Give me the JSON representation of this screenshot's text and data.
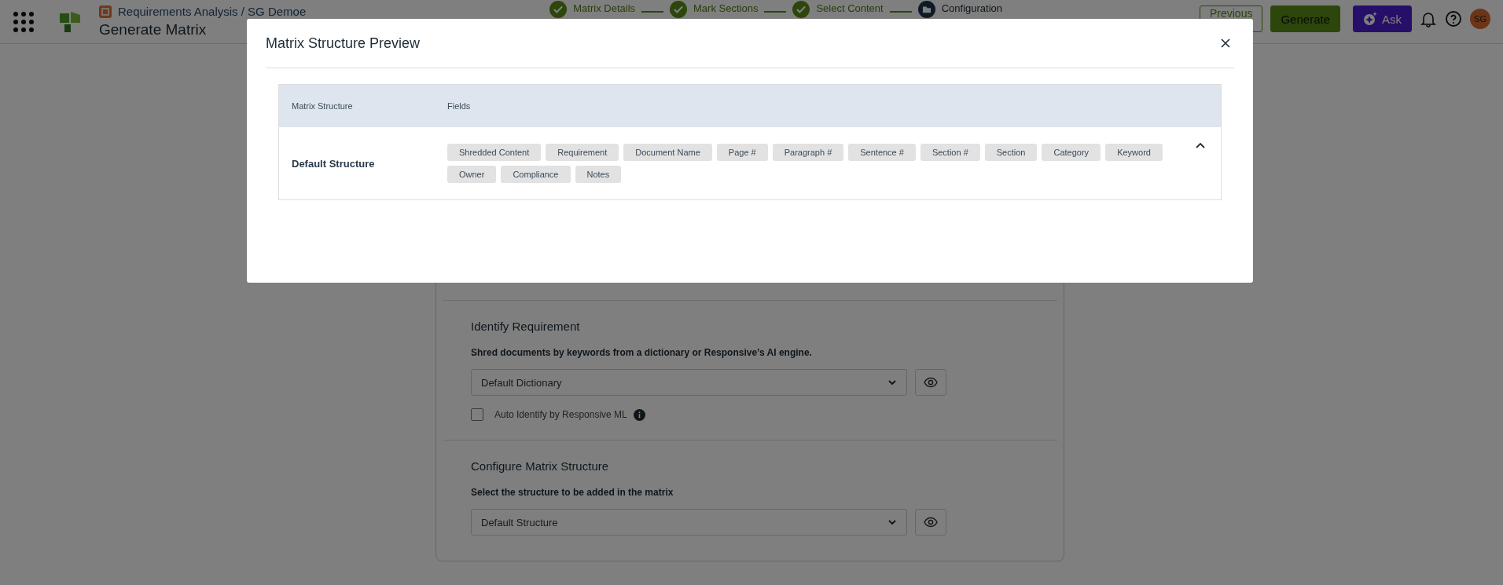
{
  "header": {
    "breadcrumb": "Requirements Analysis / SG Demoe",
    "title": "Generate Matrix",
    "steps": [
      {
        "label": "Matrix Details",
        "done": true
      },
      {
        "label": "Mark Sections",
        "done": true
      },
      {
        "label": "Select Content",
        "done": true
      },
      {
        "label": "Configuration",
        "done": false
      }
    ],
    "buttons": [
      {
        "label": "Previous",
        "kind": "outline"
      },
      {
        "label": "Generate",
        "kind": "primary"
      },
      {
        "label": "Ask",
        "kind": "ai"
      }
    ],
    "avatar": "SG"
  },
  "form": {
    "sections": [
      {
        "title": "Identify Requirement",
        "description": "Shred documents by keywords from a dictionary or Responsive’s AI engine.",
        "select": "Default Dictionary",
        "checkbox": {
          "label": "Auto Identify by Responsive ML",
          "checked": false
        }
      },
      {
        "title": "Configure Matrix Structure",
        "description": "Select the structure to be added in the matrix",
        "select": "Default Structure"
      }
    ]
  },
  "modal": {
    "title": "Matrix Structure Preview",
    "columns": [
      "Matrix Structure",
      "Fields"
    ],
    "rows": [
      {
        "name": "Default Structure",
        "expanded": true,
        "fields": [
          "Shredded Content",
          "Requirement",
          "Document Name",
          "Page #",
          "Paragraph #",
          "Sentence #",
          "Section #",
          "Section",
          "Category",
          "Keyword",
          "Owner",
          "Compliance",
          "Notes"
        ]
      }
    ]
  }
}
